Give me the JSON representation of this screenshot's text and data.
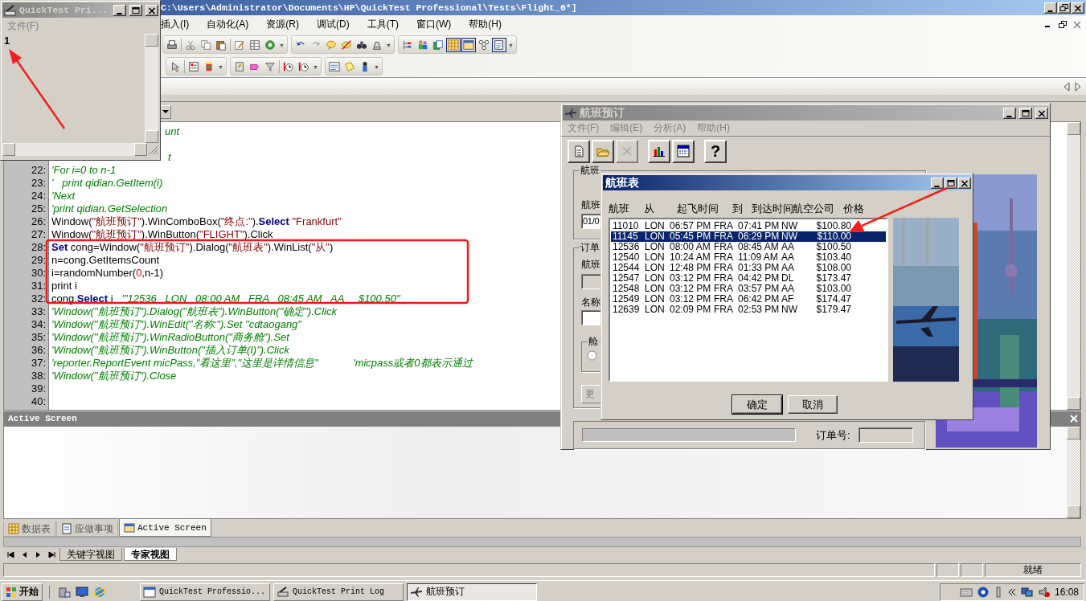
{
  "main_window": {
    "title": "C:\\Users\\Administrator\\Documents\\HP\\QuickTest Professional\\Tests\\Flight_6*]",
    "menu": [
      "插入(I)",
      "自动化(A)",
      "资源(R)",
      "调试(D)",
      "工具(T)",
      "窗口(W)",
      "帮助(H)"
    ]
  },
  "editor": {
    "lines": [
      {
        "kind": "partial",
        "segments": [
          {
            "kind": "comment",
            "text": "unt"
          }
        ]
      },
      {
        "kind": "partial",
        "segments": [
          {
            "kind": "comment",
            "text": "t"
          }
        ]
      },
      {
        "kind": "line",
        "number": "22:",
        "segments": [
          {
            "kind": "comment",
            "text": "'For i=0 to n-1"
          }
        ]
      },
      {
        "kind": "line",
        "number": "23:",
        "segments": [
          {
            "kind": "comment",
            "text": "'   print qidian.GetItem(i)"
          }
        ]
      },
      {
        "kind": "line",
        "number": "24:",
        "segments": [
          {
            "kind": "comment",
            "text": "'Next"
          }
        ]
      },
      {
        "kind": "line",
        "number": "25:",
        "segments": [
          {
            "kind": "comment",
            "text": "'print qidian.GetSelection"
          }
        ]
      },
      {
        "kind": "line",
        "number": "26:",
        "segments": [
          {
            "kind": "plain",
            "text": "Window("
          },
          {
            "kind": "string",
            "text": "\"航班预订\""
          },
          {
            "kind": "plain",
            "text": ").WinComboBox("
          },
          {
            "kind": "string",
            "text": "\"终点:\""
          },
          {
            "kind": "plain",
            "text": ")."
          },
          {
            "kind": "keyword",
            "text": "Select"
          },
          {
            "kind": "string",
            "text": " \"Frankfurt\""
          }
        ]
      },
      {
        "kind": "line",
        "number": "27:",
        "segments": [
          {
            "kind": "plain",
            "text": "Window("
          },
          {
            "kind": "string",
            "text": "\"航班预订\""
          },
          {
            "kind": "plain",
            "text": ").WinButton("
          },
          {
            "kind": "string",
            "text": "\"FLIGHT\""
          },
          {
            "kind": "plain",
            "text": ").Click"
          }
        ]
      },
      {
        "kind": "line",
        "number": "28:",
        "segments": [
          {
            "kind": "keyword",
            "text": "Set"
          },
          {
            "kind": "plain",
            "text": " cong=Window("
          },
          {
            "kind": "string",
            "text": "\"航班预订\""
          },
          {
            "kind": "plain",
            "text": ").Dialog("
          },
          {
            "kind": "string",
            "text": "\"航班表\""
          },
          {
            "kind": "plain",
            "text": ").WinList("
          },
          {
            "kind": "string",
            "text": "\"从\""
          },
          {
            "kind": "plain",
            "text": ")"
          }
        ]
      },
      {
        "kind": "line",
        "number": "29:",
        "segments": [
          {
            "kind": "plain",
            "text": "n=cong.GetItemsCount"
          }
        ]
      },
      {
        "kind": "line",
        "number": "30:",
        "segments": [
          {
            "kind": "plain",
            "text": "i=randomNumber("
          },
          {
            "kind": "number",
            "text": "0"
          },
          {
            "kind": "plain",
            "text": ",n-1)"
          }
        ]
      },
      {
        "kind": "line",
        "number": "31:",
        "segments": [
          {
            "kind": "plain",
            "text": "print i"
          }
        ]
      },
      {
        "kind": "line",
        "number": "32:",
        "segments": [
          {
            "kind": "plain",
            "text": "cong."
          },
          {
            "kind": "keyword",
            "text": "Select"
          },
          {
            "kind": "plain",
            "text": " i   "
          },
          {
            "kind": "comment",
            "text": "'\"12536   LON   08:00 AM   FRA   08:45 AM   AA     $100.50\""
          }
        ]
      },
      {
        "kind": "line",
        "number": "33:",
        "segments": [
          {
            "kind": "comment",
            "text": "'Window(\"航班预订\").Dialog(\"航班表\").WinButton(\"确定\").Click"
          }
        ]
      },
      {
        "kind": "line",
        "number": "34:",
        "segments": [
          {
            "kind": "comment",
            "text": "'Window(\"航班预订\").WinEdit(\"名称:\").Set \"cdtaogang\""
          }
        ]
      },
      {
        "kind": "line",
        "number": "35:",
        "segments": [
          {
            "kind": "comment",
            "text": "'Window(\"航班预订\").WinRadioButton(\"商务舱\").Set"
          }
        ]
      },
      {
        "kind": "line",
        "number": "36:",
        "segments": [
          {
            "kind": "comment",
            "text": "'Window(\"航班预订\").WinButton(\"插入订单(I)\").Click"
          }
        ]
      },
      {
        "kind": "line",
        "number": "37:",
        "segments": [
          {
            "kind": "comment",
            "text": "'reporter.ReportEvent micPass,\"看这里\",\"这里是详情信息\"            'micpass或者0都表示通过"
          }
        ]
      },
      {
        "kind": "line",
        "number": "38:",
        "segments": [
          {
            "kind": "comment",
            "text": "'Window(\"航班预订\").Close"
          }
        ]
      },
      {
        "kind": "line",
        "number": "39:"
      },
      {
        "kind": "line",
        "number": "40:"
      }
    ]
  },
  "active_screen": {
    "title": "Active Screen",
    "tabs": [
      {
        "label": "数据表",
        "selected": false
      },
      {
        "label": "应做事项",
        "selected": false
      },
      {
        "label": "Active Screen",
        "selected": true
      }
    ]
  },
  "view_tabs": [
    {
      "label": "关键字视图",
      "selected": false
    },
    {
      "label": "专家视图",
      "selected": true
    }
  ],
  "status_bar": {
    "text": "就绪"
  },
  "print_log": {
    "title": "QuickTest Pri...",
    "menu": [
      {
        "label": "文件(F)",
        "disabled": true
      }
    ],
    "output": "1"
  },
  "booking": {
    "title": "航班预订",
    "menu": [
      {
        "label": "文件(F)",
        "disabled": true
      },
      {
        "label": "编辑(E)",
        "disabled": true
      },
      {
        "label": "分析(A)",
        "disabled": true
      },
      {
        "label": "帮助(H)",
        "disabled": true
      }
    ],
    "toolbar": [
      {
        "kind": "new",
        "disabled": false
      },
      {
        "kind": "open",
        "disabled": false
      },
      {
        "kind": "delete",
        "disabled": true
      },
      {
        "kind": "chart",
        "disabled": false
      },
      {
        "kind": "calendar",
        "disabled": false
      },
      {
        "kind": "help",
        "label": "?",
        "disabled": false
      }
    ],
    "date_group": "航班",
    "date_label": "航班",
    "date_value": "01/0",
    "order_group": "订单",
    "flight_label": "航班",
    "name_label": "名称",
    "class_group": "舱",
    "class_radio": {
      "selected": false
    },
    "update_button": "更",
    "order_number_label": "订单号:",
    "progress": {
      "level": 0
    }
  },
  "flight_dialog": {
    "title": "航班表",
    "columns": [
      "航班",
      "从",
      "起飞时间",
      "到",
      "到达时间",
      "航空公司",
      "价格"
    ],
    "rows": [
      {
        "cells": [
          "11010",
          "LON",
          "06:57 PM",
          "FRA",
          "07:41 PM",
          "NW",
          "$100.80"
        ],
        "selected": false
      },
      {
        "cells": [
          "11145",
          "LON",
          "05:45 PM",
          "FRA",
          "06:29 PM",
          "NW",
          "$110.00"
        ],
        "selected": true
      },
      {
        "cells": [
          "12536",
          "LON",
          "08:00 AM",
          "FRA",
          "08:45 AM",
          "AA",
          "$100.50"
        ],
        "selected": false
      },
      {
        "cells": [
          "12540",
          "LON",
          "10:24 AM",
          "FRA",
          "11:09 AM",
          "AA",
          "$103.40"
        ],
        "selected": false
      },
      {
        "cells": [
          "12544",
          "LON",
          "12:48 PM",
          "FRA",
          "01:33 PM",
          "AA",
          "$108.00"
        ],
        "selected": false
      },
      {
        "cells": [
          "12547",
          "LON",
          "03:12 PM",
          "FRA",
          "04:42 PM",
          "DL",
          "$173.47"
        ],
        "selected": false
      },
      {
        "cells": [
          "12548",
          "LON",
          "03:12 PM",
          "FRA",
          "03:57 PM",
          "AA",
          "$103.00"
        ],
        "selected": false
      },
      {
        "cells": [
          "12549",
          "LON",
          "03:12 PM",
          "FRA",
          "06:42 PM",
          "AF",
          "$174.47"
        ],
        "selected": false
      },
      {
        "cells": [
          "12639",
          "LON",
          "02:09 PM",
          "FRA",
          "02:53 PM",
          "NW",
          "$179.47"
        ],
        "selected": false
      }
    ],
    "buttons": [
      {
        "label": "确定",
        "default": true
      },
      {
        "label": "取消",
        "default": false
      }
    ]
  },
  "taskbar": {
    "start": "开始",
    "tasks": [
      {
        "label": "QuickTest Professio...",
        "kind": "qtp",
        "selected": false
      },
      {
        "label": "QuickTest Print Log",
        "kind": "log",
        "selected": false
      },
      {
        "label": "航班预订",
        "kind": "plane",
        "selected": true
      }
    ],
    "clock": "16:08"
  }
}
